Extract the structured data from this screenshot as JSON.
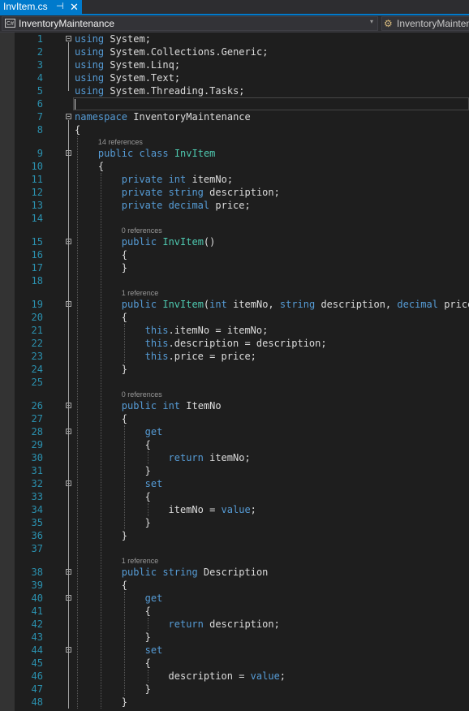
{
  "tab": {
    "filename": "InvItem.cs",
    "pin_glyph": "⊣",
    "close_glyph": "✕"
  },
  "nav": {
    "project": "InventoryMaintenance",
    "class_member": "InventoryMaintenance.InvItem",
    "dropdown_glyph": "▾",
    "cs_icon_text": "C#",
    "class_icon_glyph": "⚙"
  },
  "colors": {
    "keyword": "#569cd6",
    "type": "#4ec9b0",
    "plain": "#dcdcdc",
    "line_number": "#2b91af",
    "accent": "#007acc"
  },
  "lines": [
    {
      "n": "1",
      "indent": 0,
      "fold": true,
      "segs": [
        [
          "using",
          "k"
        ],
        [
          " System;",
          "p"
        ]
      ]
    },
    {
      "n": "2",
      "indent": 0,
      "segs": [
        [
          "using",
          "k"
        ],
        [
          " System.Collections.Generic;",
          "p"
        ]
      ]
    },
    {
      "n": "3",
      "indent": 0,
      "segs": [
        [
          "using",
          "k"
        ],
        [
          " System.Linq;",
          "p"
        ]
      ]
    },
    {
      "n": "4",
      "indent": 0,
      "segs": [
        [
          "using",
          "k"
        ],
        [
          " System.Text;",
          "p"
        ]
      ]
    },
    {
      "n": "5",
      "indent": 0,
      "segs": [
        [
          "using",
          "k"
        ],
        [
          " System.Threading.Tasks;",
          "p"
        ]
      ]
    },
    {
      "n": "6",
      "indent": 0,
      "segs": []
    },
    {
      "n": "7",
      "indent": 0,
      "fold": true,
      "segs": [
        [
          "namespace",
          "k"
        ],
        [
          " InventoryMaintenance",
          "p"
        ]
      ]
    },
    {
      "n": "8",
      "indent": 0,
      "segs": [
        [
          "{",
          "p"
        ]
      ]
    },
    {
      "n": "9",
      "indent": 1,
      "fold": true,
      "lens": "14 references",
      "segs": [
        [
          "public",
          "k"
        ],
        [
          " ",
          "p"
        ],
        [
          "class",
          "k"
        ],
        [
          " ",
          "p"
        ],
        [
          "InvItem",
          "t"
        ]
      ]
    },
    {
      "n": "10",
      "indent": 1,
      "segs": [
        [
          "{",
          "p"
        ]
      ]
    },
    {
      "n": "11",
      "indent": 2,
      "segs": [
        [
          "private",
          "k"
        ],
        [
          " ",
          "p"
        ],
        [
          "int",
          "k"
        ],
        [
          " itemNo;",
          "p"
        ]
      ]
    },
    {
      "n": "12",
      "indent": 2,
      "segs": [
        [
          "private",
          "k"
        ],
        [
          " ",
          "p"
        ],
        [
          "string",
          "k"
        ],
        [
          " description;",
          "p"
        ]
      ]
    },
    {
      "n": "13",
      "indent": 2,
      "segs": [
        [
          "private",
          "k"
        ],
        [
          " ",
          "p"
        ],
        [
          "decimal",
          "k"
        ],
        [
          " price;",
          "p"
        ]
      ]
    },
    {
      "n": "14",
      "indent": 0,
      "segs": []
    },
    {
      "n": "15",
      "indent": 2,
      "fold": true,
      "lens": "0 references",
      "segs": [
        [
          "public",
          "k"
        ],
        [
          " ",
          "p"
        ],
        [
          "InvItem",
          "t"
        ],
        [
          "()",
          "p"
        ]
      ]
    },
    {
      "n": "16",
      "indent": 2,
      "segs": [
        [
          "{",
          "p"
        ]
      ]
    },
    {
      "n": "17",
      "indent": 2,
      "segs": [
        [
          "}",
          "p"
        ]
      ]
    },
    {
      "n": "18",
      "indent": 0,
      "segs": []
    },
    {
      "n": "19",
      "indent": 2,
      "fold": true,
      "lens": "1 reference",
      "segs": [
        [
          "public",
          "k"
        ],
        [
          " ",
          "p"
        ],
        [
          "InvItem",
          "t"
        ],
        [
          "(",
          "p"
        ],
        [
          "int",
          "k"
        ],
        [
          " itemNo, ",
          "p"
        ],
        [
          "string",
          "k"
        ],
        [
          " description, ",
          "p"
        ],
        [
          "decimal",
          "k"
        ],
        [
          " price)",
          "p"
        ]
      ]
    },
    {
      "n": "20",
      "indent": 2,
      "segs": [
        [
          "{",
          "p"
        ]
      ]
    },
    {
      "n": "21",
      "indent": 3,
      "segs": [
        [
          "this",
          "k"
        ],
        [
          ".itemNo = itemNo;",
          "p"
        ]
      ]
    },
    {
      "n": "22",
      "indent": 3,
      "segs": [
        [
          "this",
          "k"
        ],
        [
          ".description = description;",
          "p"
        ]
      ]
    },
    {
      "n": "23",
      "indent": 3,
      "segs": [
        [
          "this",
          "k"
        ],
        [
          ".price = price;",
          "p"
        ]
      ]
    },
    {
      "n": "24",
      "indent": 2,
      "segs": [
        [
          "}",
          "p"
        ]
      ]
    },
    {
      "n": "25",
      "indent": 0,
      "segs": []
    },
    {
      "n": "26",
      "indent": 2,
      "fold": true,
      "lens": "0 references",
      "segs": [
        [
          "public",
          "k"
        ],
        [
          " ",
          "p"
        ],
        [
          "int",
          "k"
        ],
        [
          " ItemNo",
          "p"
        ]
      ]
    },
    {
      "n": "27",
      "indent": 2,
      "segs": [
        [
          "{",
          "p"
        ]
      ]
    },
    {
      "n": "28",
      "indent": 3,
      "fold": true,
      "segs": [
        [
          "get",
          "k"
        ]
      ]
    },
    {
      "n": "29",
      "indent": 3,
      "segs": [
        [
          "{",
          "p"
        ]
      ]
    },
    {
      "n": "30",
      "indent": 4,
      "segs": [
        [
          "return",
          "k"
        ],
        [
          " itemNo;",
          "p"
        ]
      ]
    },
    {
      "n": "31",
      "indent": 3,
      "segs": [
        [
          "}",
          "p"
        ]
      ]
    },
    {
      "n": "32",
      "indent": 3,
      "fold": true,
      "segs": [
        [
          "set",
          "k"
        ]
      ]
    },
    {
      "n": "33",
      "indent": 3,
      "segs": [
        [
          "{",
          "p"
        ]
      ]
    },
    {
      "n": "34",
      "indent": 4,
      "segs": [
        [
          "itemNo = ",
          "p"
        ],
        [
          "value",
          "k"
        ],
        [
          ";",
          "p"
        ]
      ]
    },
    {
      "n": "35",
      "indent": 3,
      "segs": [
        [
          "}",
          "p"
        ]
      ]
    },
    {
      "n": "36",
      "indent": 2,
      "segs": [
        [
          "}",
          "p"
        ]
      ]
    },
    {
      "n": "37",
      "indent": 0,
      "segs": []
    },
    {
      "n": "38",
      "indent": 2,
      "fold": true,
      "lens": "1 reference",
      "segs": [
        [
          "public",
          "k"
        ],
        [
          " ",
          "p"
        ],
        [
          "string",
          "k"
        ],
        [
          " Description",
          "p"
        ]
      ]
    },
    {
      "n": "39",
      "indent": 2,
      "segs": [
        [
          "{",
          "p"
        ]
      ]
    },
    {
      "n": "40",
      "indent": 3,
      "fold": true,
      "segs": [
        [
          "get",
          "k"
        ]
      ]
    },
    {
      "n": "41",
      "indent": 3,
      "segs": [
        [
          "{",
          "p"
        ]
      ]
    },
    {
      "n": "42",
      "indent": 4,
      "segs": [
        [
          "return",
          "k"
        ],
        [
          " description;",
          "p"
        ]
      ]
    },
    {
      "n": "43",
      "indent": 3,
      "segs": [
        [
          "}",
          "p"
        ]
      ]
    },
    {
      "n": "44",
      "indent": 3,
      "fold": true,
      "segs": [
        [
          "set",
          "k"
        ]
      ]
    },
    {
      "n": "45",
      "indent": 3,
      "segs": [
        [
          "{",
          "p"
        ]
      ]
    },
    {
      "n": "46",
      "indent": 4,
      "segs": [
        [
          "description = ",
          "p"
        ],
        [
          "value",
          "k"
        ],
        [
          ";",
          "p"
        ]
      ]
    },
    {
      "n": "47",
      "indent": 3,
      "segs": [
        [
          "}",
          "p"
        ]
      ]
    },
    {
      "n": "48",
      "indent": 2,
      "segs": [
        [
          "}",
          "p"
        ]
      ]
    }
  ]
}
